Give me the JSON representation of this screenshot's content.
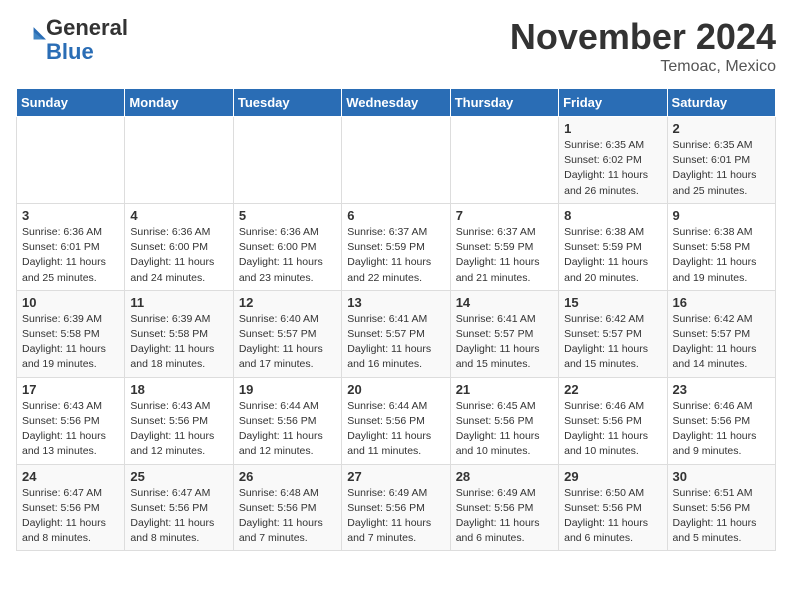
{
  "header": {
    "logo_general": "General",
    "logo_blue": "Blue",
    "title": "November 2024",
    "location": "Temoac, Mexico"
  },
  "weekdays": [
    "Sunday",
    "Monday",
    "Tuesday",
    "Wednesday",
    "Thursday",
    "Friday",
    "Saturday"
  ],
  "weeks": [
    [
      {
        "day": "",
        "info": ""
      },
      {
        "day": "",
        "info": ""
      },
      {
        "day": "",
        "info": ""
      },
      {
        "day": "",
        "info": ""
      },
      {
        "day": "",
        "info": ""
      },
      {
        "day": "1",
        "info": "Sunrise: 6:35 AM\nSunset: 6:02 PM\nDaylight: 11 hours and 26 minutes."
      },
      {
        "day": "2",
        "info": "Sunrise: 6:35 AM\nSunset: 6:01 PM\nDaylight: 11 hours and 25 minutes."
      }
    ],
    [
      {
        "day": "3",
        "info": "Sunrise: 6:36 AM\nSunset: 6:01 PM\nDaylight: 11 hours and 25 minutes."
      },
      {
        "day": "4",
        "info": "Sunrise: 6:36 AM\nSunset: 6:00 PM\nDaylight: 11 hours and 24 minutes."
      },
      {
        "day": "5",
        "info": "Sunrise: 6:36 AM\nSunset: 6:00 PM\nDaylight: 11 hours and 23 minutes."
      },
      {
        "day": "6",
        "info": "Sunrise: 6:37 AM\nSunset: 5:59 PM\nDaylight: 11 hours and 22 minutes."
      },
      {
        "day": "7",
        "info": "Sunrise: 6:37 AM\nSunset: 5:59 PM\nDaylight: 11 hours and 21 minutes."
      },
      {
        "day": "8",
        "info": "Sunrise: 6:38 AM\nSunset: 5:59 PM\nDaylight: 11 hours and 20 minutes."
      },
      {
        "day": "9",
        "info": "Sunrise: 6:38 AM\nSunset: 5:58 PM\nDaylight: 11 hours and 19 minutes."
      }
    ],
    [
      {
        "day": "10",
        "info": "Sunrise: 6:39 AM\nSunset: 5:58 PM\nDaylight: 11 hours and 19 minutes."
      },
      {
        "day": "11",
        "info": "Sunrise: 6:39 AM\nSunset: 5:58 PM\nDaylight: 11 hours and 18 minutes."
      },
      {
        "day": "12",
        "info": "Sunrise: 6:40 AM\nSunset: 5:57 PM\nDaylight: 11 hours and 17 minutes."
      },
      {
        "day": "13",
        "info": "Sunrise: 6:41 AM\nSunset: 5:57 PM\nDaylight: 11 hours and 16 minutes."
      },
      {
        "day": "14",
        "info": "Sunrise: 6:41 AM\nSunset: 5:57 PM\nDaylight: 11 hours and 15 minutes."
      },
      {
        "day": "15",
        "info": "Sunrise: 6:42 AM\nSunset: 5:57 PM\nDaylight: 11 hours and 15 minutes."
      },
      {
        "day": "16",
        "info": "Sunrise: 6:42 AM\nSunset: 5:57 PM\nDaylight: 11 hours and 14 minutes."
      }
    ],
    [
      {
        "day": "17",
        "info": "Sunrise: 6:43 AM\nSunset: 5:56 PM\nDaylight: 11 hours and 13 minutes."
      },
      {
        "day": "18",
        "info": "Sunrise: 6:43 AM\nSunset: 5:56 PM\nDaylight: 11 hours and 12 minutes."
      },
      {
        "day": "19",
        "info": "Sunrise: 6:44 AM\nSunset: 5:56 PM\nDaylight: 11 hours and 12 minutes."
      },
      {
        "day": "20",
        "info": "Sunrise: 6:44 AM\nSunset: 5:56 PM\nDaylight: 11 hours and 11 minutes."
      },
      {
        "day": "21",
        "info": "Sunrise: 6:45 AM\nSunset: 5:56 PM\nDaylight: 11 hours and 10 minutes."
      },
      {
        "day": "22",
        "info": "Sunrise: 6:46 AM\nSunset: 5:56 PM\nDaylight: 11 hours and 10 minutes."
      },
      {
        "day": "23",
        "info": "Sunrise: 6:46 AM\nSunset: 5:56 PM\nDaylight: 11 hours and 9 minutes."
      }
    ],
    [
      {
        "day": "24",
        "info": "Sunrise: 6:47 AM\nSunset: 5:56 PM\nDaylight: 11 hours and 8 minutes."
      },
      {
        "day": "25",
        "info": "Sunrise: 6:47 AM\nSunset: 5:56 PM\nDaylight: 11 hours and 8 minutes."
      },
      {
        "day": "26",
        "info": "Sunrise: 6:48 AM\nSunset: 5:56 PM\nDaylight: 11 hours and 7 minutes."
      },
      {
        "day": "27",
        "info": "Sunrise: 6:49 AM\nSunset: 5:56 PM\nDaylight: 11 hours and 7 minutes."
      },
      {
        "day": "28",
        "info": "Sunrise: 6:49 AM\nSunset: 5:56 PM\nDaylight: 11 hours and 6 minutes."
      },
      {
        "day": "29",
        "info": "Sunrise: 6:50 AM\nSunset: 5:56 PM\nDaylight: 11 hours and 6 minutes."
      },
      {
        "day": "30",
        "info": "Sunrise: 6:51 AM\nSunset: 5:56 PM\nDaylight: 11 hours and 5 minutes."
      }
    ]
  ]
}
